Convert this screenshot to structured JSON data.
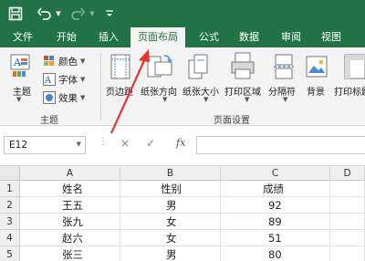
{
  "tabs": [
    "文件",
    "开始",
    "插入",
    "页面布局",
    "公式",
    "数据",
    "审阅",
    "视图"
  ],
  "ribbon": {
    "theme_group": {
      "main_label": "主题",
      "colors_label": "颜色",
      "fonts_label": "字体",
      "effects_label": "效果",
      "group_label": "主题"
    },
    "page_setup": {
      "items": [
        "页边距",
        "纸张方向",
        "纸张大小",
        "打印区域",
        "分隔符",
        "背景",
        "打印标题"
      ],
      "group_label": "页面设置"
    }
  },
  "formula_bar": {
    "name_box": "E12",
    "cancel": "×",
    "enter": "✓",
    "fx": "fx",
    "value": ""
  },
  "sheet": {
    "columns": [
      "A",
      "B",
      "C",
      "D"
    ],
    "rows": [
      {
        "num": "1",
        "a": "姓名",
        "b": "性别",
        "c": "成绩"
      },
      {
        "num": "2",
        "a": "王五",
        "b": "男",
        "c": "92"
      },
      {
        "num": "3",
        "a": "张九",
        "b": "女",
        "c": "89"
      },
      {
        "num": "4",
        "a": "赵六",
        "b": "女",
        "c": "51"
      },
      {
        "num": "5",
        "a": "张三",
        "b": "男",
        "c": "80"
      }
    ]
  },
  "colors": {
    "brand": "#217346",
    "ribbon": "#f3f3f3",
    "annotation": "#e8322c"
  },
  "icons": {
    "save": "save-icon",
    "undo": "undo-icon",
    "redo": "redo-icon"
  }
}
